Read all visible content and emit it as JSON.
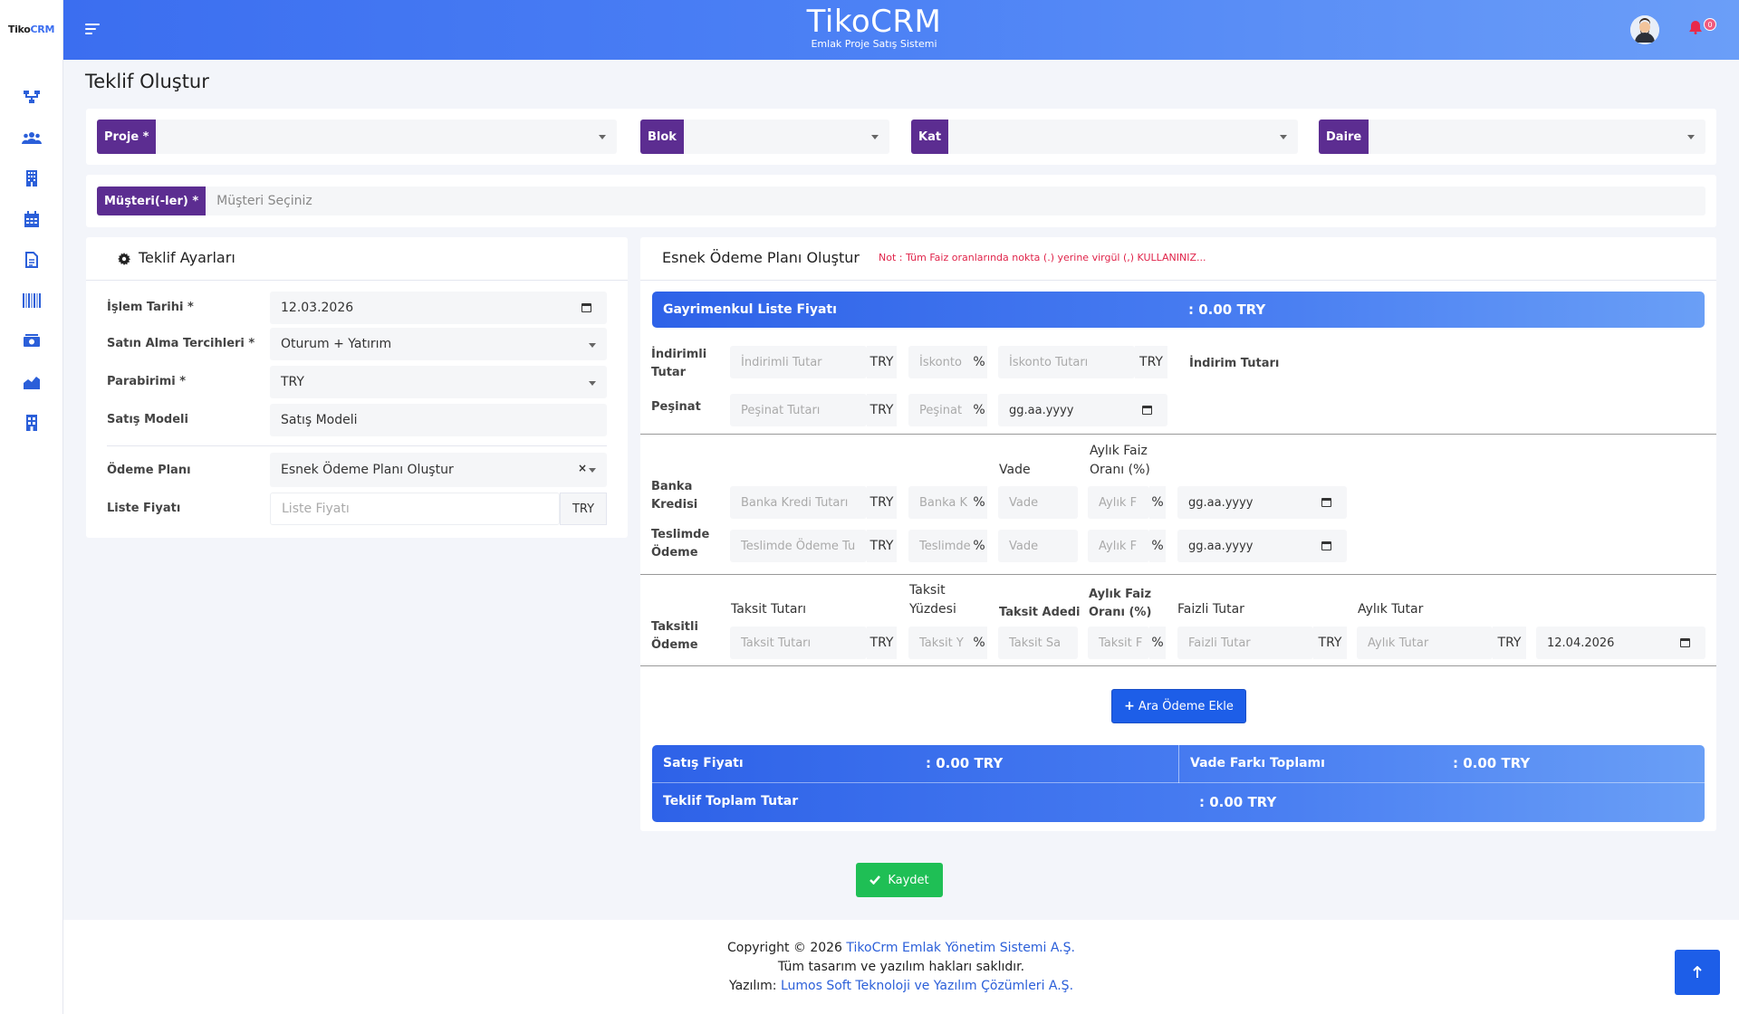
{
  "app": {
    "brand_name": "TikoCRM",
    "brand_sub": "Emlak Proje Satış Sistemi",
    "sidebar_logo_a": "Tiko",
    "sidebar_logo_b": "CRM",
    "notif_count": "0"
  },
  "page": {
    "title": "Teklif Oluştur"
  },
  "selectors": {
    "proje": "Proje *",
    "blok": "Blok",
    "kat": "Kat",
    "daire": "Daire"
  },
  "customer": {
    "label": "Müşteri(-ler) *",
    "placeholder": "Müşteri Seçiniz"
  },
  "settings": {
    "title": "Teklif Ayarları",
    "islem_tarihi_label": "İşlem Tarihi *",
    "islem_tarihi": "12.03.2026",
    "satin_alma_label": "Satın Alma Tercihleri *",
    "satin_alma": "Oturum + Yatırım",
    "parabirimi_label": "Parabirimi *",
    "parabirimi": "TRY",
    "satis_modeli_label": "Satış Modeli",
    "satis_modeli": "Satış Modeli",
    "odeme_plani_label": "Ödeme Planı",
    "odeme_plani": "Esnek Ödeme Planı Oluştur",
    "liste_fiyati_label": "Liste Fiyatı",
    "liste_fiyati_ph": "Liste Fiyatı",
    "liste_fiyati_cur": "TRY"
  },
  "flex": {
    "title": "Esnek Ödeme Planı Oluştur",
    "note": "Not : Tüm Faiz oranlarında nokta (.) yerine virgül (,) KULLANINIZ...",
    "list_price_label": "Gayrimenkul Liste Fiyatı",
    "list_price_value": ": 0.00 TRY",
    "indirimli_label": "İndirimli Tutar",
    "indirimli_ph": "İndirimli Tutar",
    "iskonto_ph": "İskonto",
    "iskonto_tutar_ph": "İskonto Tutarı",
    "indirim_tutari": "İndirim Tutarı",
    "pesinat_label": "Peşinat",
    "pesinat_ph": "Peşinat Tutarı",
    "pesinat_pct_ph": "Peşinat",
    "date_ph": "gg.aa.yyyy",
    "vade_header": "Vade",
    "aylik_faiz_header": "Aylık Faiz Oranı (%)",
    "banka_label": "Banka Kredisi",
    "banka_ph": "Banka Kredi Tutarı",
    "banka_pct_ph": "Banka K",
    "vade_ph": "Vade",
    "aylik_f_ph": "Aylık F",
    "teslimde_label": "Teslimde Ödeme",
    "teslimde_ph": "Teslimde Ödeme Tu",
    "teslimde_pct_ph": "Teslimde",
    "taksit_tutari_h": "Taksit Tutarı",
    "taksit_yuzdesi_h": "Taksit Yüzdesi",
    "taksit_adedi_h": "Taksit Adedi",
    "aylik_faiz_h2": "Aylık Faiz Oranı (%)",
    "faizli_tutar_h": "Faizli Tutar",
    "aylik_tutar_h": "Aylık Tutar",
    "taksitli_label": "Taksitli Ödeme",
    "taksit_tutari_ph": "Taksit Tutarı",
    "taksit_y_ph": "Taksit Y",
    "taksit_sa_ph": "Taksit Sa",
    "taksit_f_ph": "Taksit F",
    "faizli_ph": "Faizli Tutar",
    "aylik_tutar_ph": "Aylık Tutar",
    "taksit_date": "12.04.2026",
    "currency": "TRY",
    "pct": "%",
    "add_btn": "Ara Ödeme Ekle",
    "satis_fiyati_label": "Satış Fiyatı",
    "satis_fiyati_value": ": 0.00 TRY",
    "vade_farki_label": "Vade Farkı Toplamı",
    "vade_farki_value": ": 0.00 TRY",
    "toplam_label": "Teklif Toplam Tutar",
    "toplam_value": ": 0.00 TRY"
  },
  "save_btn": "Kaydet",
  "footer": {
    "line1_pre": "Copyright © 2026 ",
    "line1_link": "TikoCrm Emlak Yönetim Sistemi A.Ş.",
    "line2": "Tüm tasarım ve yazılım hakları saklıdır.",
    "line3_pre": "Yazılım: ",
    "line3_link": "Lumos Soft Teknoloji ve Yazılım Çözümleri A.Ş."
  },
  "colors": {
    "primary": "#3b6ef0",
    "purple": "#5c2d91",
    "green": "#1fbf55",
    "red_note": "#e0244a"
  }
}
